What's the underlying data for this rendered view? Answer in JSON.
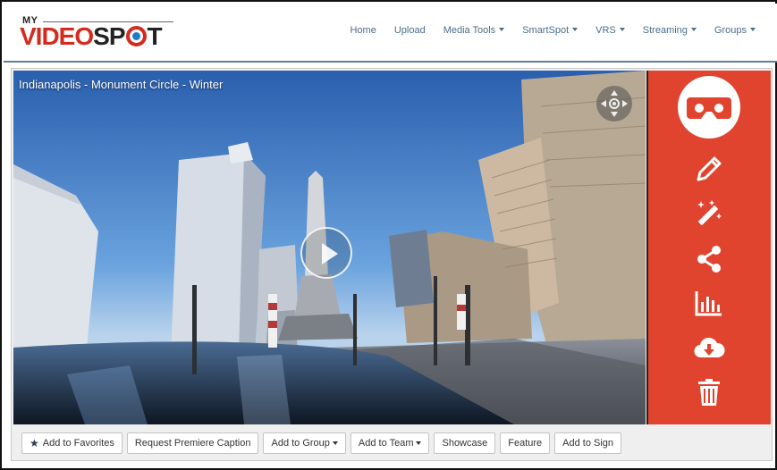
{
  "brand": {
    "prefix": "MY",
    "word_part1": "VIDEO",
    "word_part2": "SP",
    "word_part3": "T"
  },
  "nav": {
    "items": [
      {
        "label": "Home",
        "dropdown": false
      },
      {
        "label": "Upload",
        "dropdown": false
      },
      {
        "label": "Media Tools",
        "dropdown": true
      },
      {
        "label": "SmartSpot",
        "dropdown": true
      },
      {
        "label": "VRS",
        "dropdown": true
      },
      {
        "label": "Streaming",
        "dropdown": true
      },
      {
        "label": "Groups",
        "dropdown": true
      }
    ]
  },
  "video": {
    "title": "Indianapolis - Monument Circle - Winter"
  },
  "sidebar": {
    "icons": [
      "vr-headset-icon",
      "pencil-icon",
      "magic-wand-icon",
      "share-icon",
      "bar-chart-icon",
      "cloud-download-icon",
      "trash-icon"
    ]
  },
  "actions": {
    "add_to_favorites": "Add to Favorites",
    "request_premiere_caption": "Request Premiere Caption",
    "add_to_group": "Add to Group",
    "add_to_team": "Add to Team",
    "showcase": "Showcase",
    "feature": "Feature",
    "add_to_sign": "Add to Sign"
  },
  "colors": {
    "brand_red": "#d52b1e",
    "sidebar_red": "#e0442f",
    "nav_link": "#4a6d8a"
  }
}
